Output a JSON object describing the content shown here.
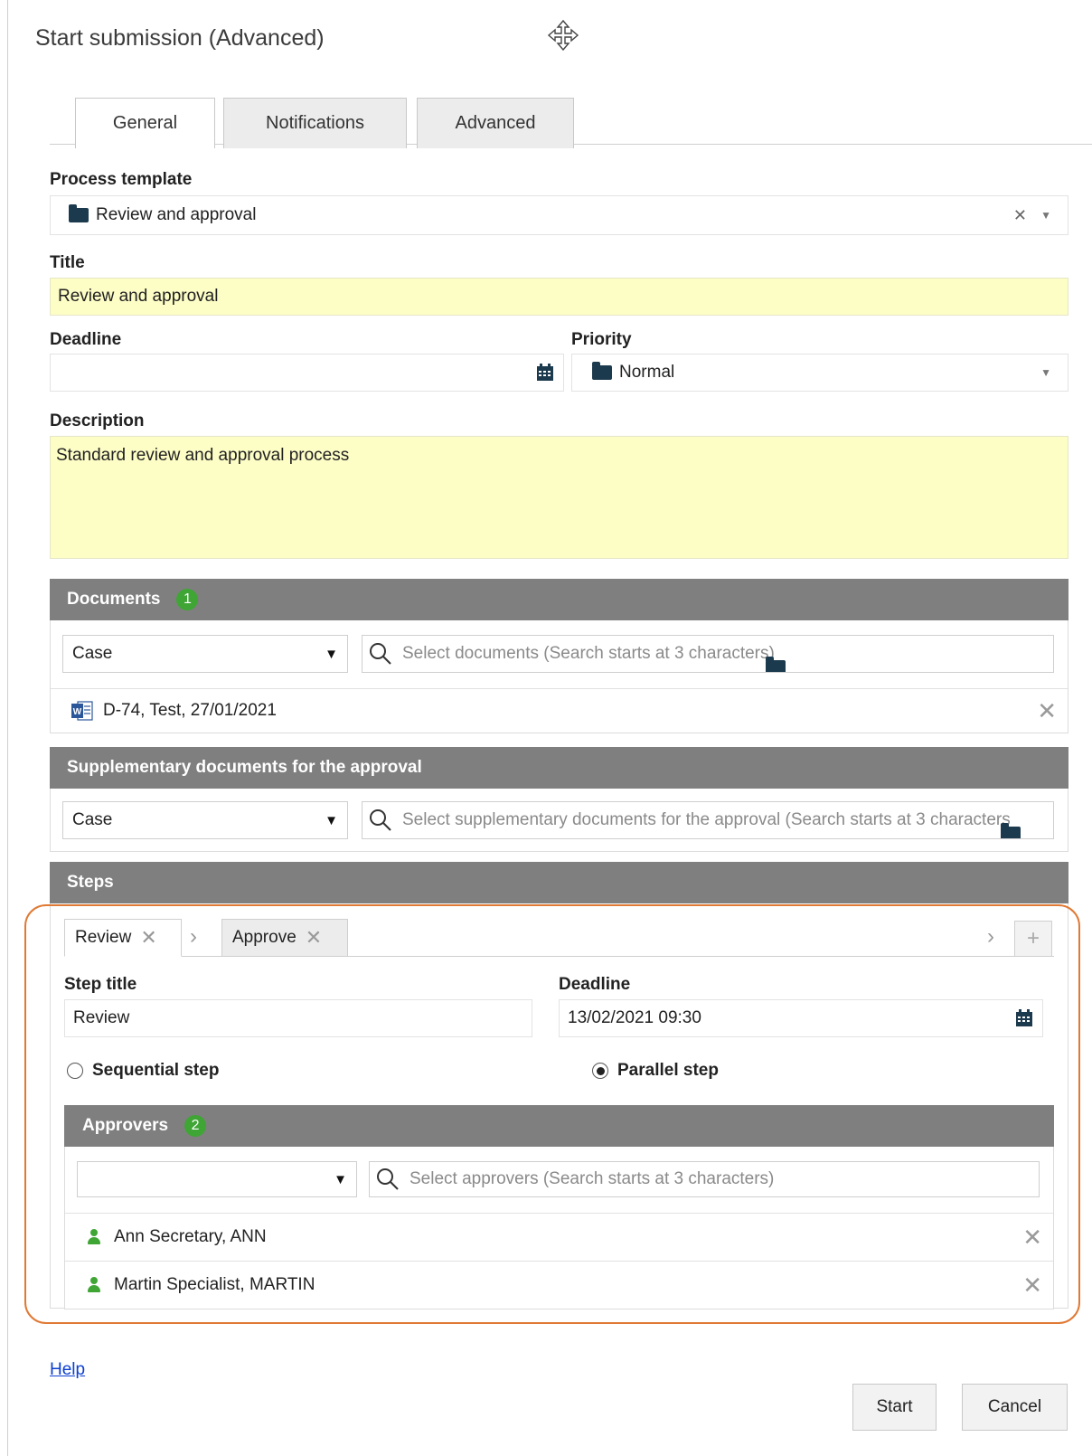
{
  "dialog": {
    "title": "Start submission (Advanced)"
  },
  "tabs": [
    {
      "label": "General",
      "active": true
    },
    {
      "label": "Notifications",
      "active": false
    },
    {
      "label": "Advanced",
      "active": false
    }
  ],
  "process_template": {
    "label": "Process template",
    "value": "Review and approval",
    "icon": "folder-icon"
  },
  "title_field": {
    "label": "Title",
    "value": "Review and approval"
  },
  "deadline": {
    "label": "Deadline",
    "value": "",
    "icon": "calendar-icon"
  },
  "priority": {
    "label": "Priority",
    "value": "Normal",
    "icon": "folder-icon"
  },
  "description": {
    "label": "Description",
    "value": "Standard review and approval process"
  },
  "documents": {
    "header": "Documents",
    "count": "1",
    "scope": "Case",
    "search_placeholder": "Select documents (Search starts at 3 characters)",
    "items": [
      {
        "label": "D-74, Test, 27/01/2021",
        "icon": "word-doc-icon"
      }
    ]
  },
  "supplementary": {
    "header": "Supplementary documents for the approval",
    "scope": "Case",
    "search_placeholder": "Select supplementary documents for the approval (Search starts at 3 characters)"
  },
  "steps": {
    "header": "Steps",
    "tabs": [
      {
        "label": "Review",
        "active": true
      },
      {
        "label": "Approve",
        "active": false
      }
    ],
    "step_title_label": "Step title",
    "step_title_value": "Review",
    "deadline_label": "Deadline",
    "deadline_value": "13/02/2021 09:30",
    "sequential_label": "Sequential step",
    "parallel_label": "Parallel step",
    "selected_type": "parallel"
  },
  "approvers": {
    "header": "Approvers",
    "count": "2",
    "scope": "",
    "search_placeholder": "Select approvers (Search starts at 3 characters)",
    "items": [
      {
        "label": "Ann Secretary, ANN",
        "icon": "person-icon"
      },
      {
        "label": "Martin Specialist, MARTIN",
        "icon": "person-icon"
      }
    ]
  },
  "footer": {
    "help": "Help",
    "start": "Start",
    "cancel": "Cancel"
  },
  "colors": {
    "section_header": "#7f7f7f",
    "badge": "#3fa535",
    "highlight_field": "#fdfdc6",
    "annotation_border": "#e07934",
    "link": "#0b3fd1"
  }
}
